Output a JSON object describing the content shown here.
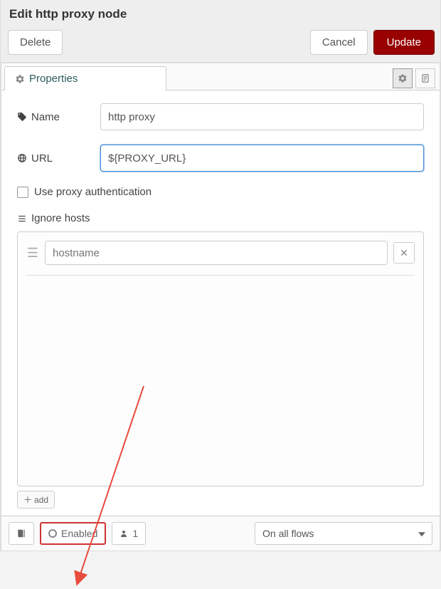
{
  "header": {
    "title": "Edit http proxy node",
    "delete": "Delete",
    "cancel": "Cancel",
    "update": "Update"
  },
  "tabs": {
    "properties": "Properties"
  },
  "form": {
    "name_label": "Name",
    "name_value": "http proxy",
    "url_label": "URL",
    "url_value": "${PROXY_URL}",
    "use_auth_label": "Use proxy authentication",
    "ignore_hosts_label": "Ignore hosts",
    "hostname_placeholder": "hostname",
    "add_label": "add"
  },
  "footer": {
    "enabled_label": "Enabled",
    "instance_count": "1",
    "scope_selected": "On all flows"
  }
}
